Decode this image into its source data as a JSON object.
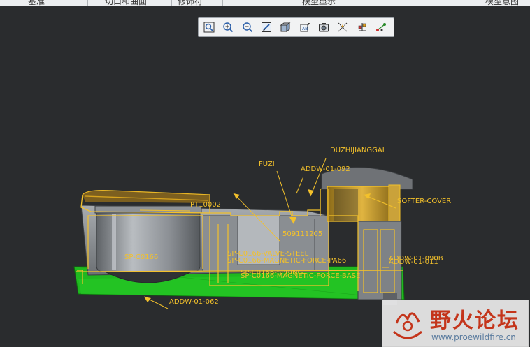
{
  "ribbon": {
    "labels": [
      "基准",
      "切口和曲面",
      "修饰符",
      "模型显示",
      "模型意图"
    ]
  },
  "toolbar": {
    "icons": [
      "refit-icon",
      "zoom-in-icon",
      "zoom-out-icon",
      "repaint-icon",
      "display-style-icon",
      "saved-views-icon",
      "view-manager-icon",
      "datum-display-icon",
      "spin-center-icon",
      "annotation-display-icon"
    ]
  },
  "model": {
    "labels": [
      "DUZHIJIANGGAI",
      "FUZI",
      "ADDW-01-092",
      "SOFTER-COVER",
      "PT10002",
      "509111205",
      "SP-C0166",
      "SP-C0166-MAGNETIC-FORCE-PA66",
      "SP-C0166-VALVE-STEEL",
      "SP-C0166-SPRING",
      "SP-C0166-MAGNETIC-FORCE-BASE",
      "ADDW-01-011",
      "ADDW-01-090B",
      "ADDW-01-062"
    ]
  },
  "watermark": {
    "title": "野火论坛",
    "url": "www.proewildfire.cn"
  },
  "colors": {
    "background": "#2b2d2f",
    "highlight": "#f3c12b",
    "base_plate": "#1fb81f",
    "body_gray": "#9ea2a6"
  }
}
